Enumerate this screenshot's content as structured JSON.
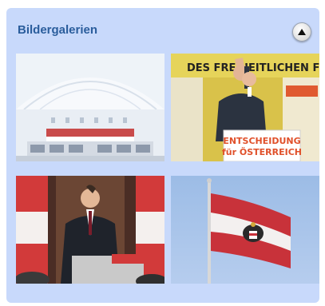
{
  "widget": {
    "title": "Bildergalerien",
    "collapse_icon": "chevron-up-icon",
    "colors": {
      "background": "#c8d9fb",
      "title": "#2a5d9c"
    }
  },
  "thumbnails": [
    {
      "scene": "hall-stage-event",
      "banner_text": ""
    },
    {
      "scene": "speaker-at-podium",
      "podium_line1": "ENTSCHEIDUNG",
      "podium_line2": "für ÖSTERREICH",
      "banner_text": "DES FREIHEITLICHEN FPÖ"
    },
    {
      "scene": "speaker-with-flags"
    },
    {
      "scene": "flag-with-eagle"
    }
  ]
}
